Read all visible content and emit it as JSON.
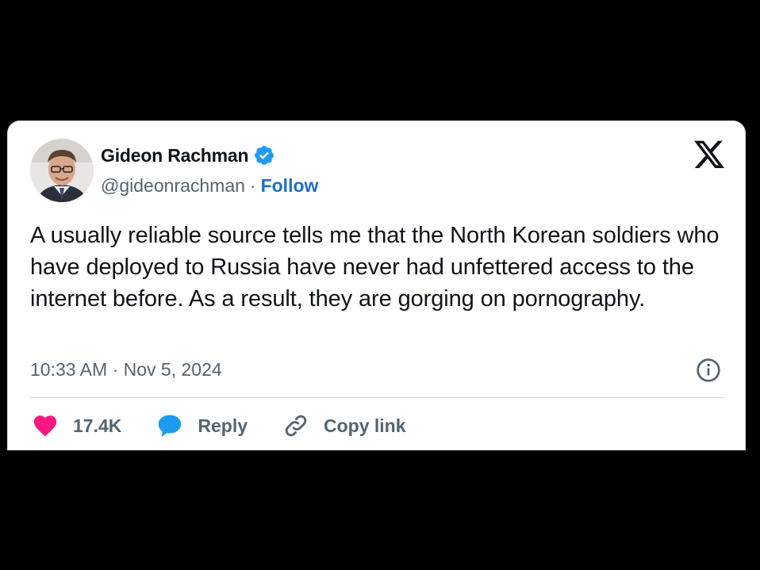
{
  "user": {
    "name": "Gideon Rachman",
    "handle": "@gideonrachman",
    "separator": "·",
    "follow_label": "Follow",
    "verified": true
  },
  "tweet": {
    "text": "A usually reliable source tells me that the North Korean soldiers who have deployed to Russia have never had unfettered access to the internet before. As a result, they are gorging on pornography.",
    "timestamp": "10:33 AM · Nov 5, 2024"
  },
  "actions": {
    "likes": "17.4K",
    "reply_label": "Reply",
    "copy_link_label": "Copy link"
  },
  "icons": {
    "brand": "x-logo-icon",
    "verified": "verified-badge-icon",
    "info": "info-icon",
    "like": "heart-icon",
    "reply": "speech-bubble-icon",
    "copy": "link-icon"
  },
  "colors": {
    "background": "#000000",
    "card": "#ffffff",
    "text": "#0f1419",
    "secondary_text": "#536471",
    "follow": "#1d6fc4",
    "verified": "#1d9bf0",
    "heart": "#f91880",
    "reply": "#1d9bf0",
    "divider": "#cfd9de"
  }
}
